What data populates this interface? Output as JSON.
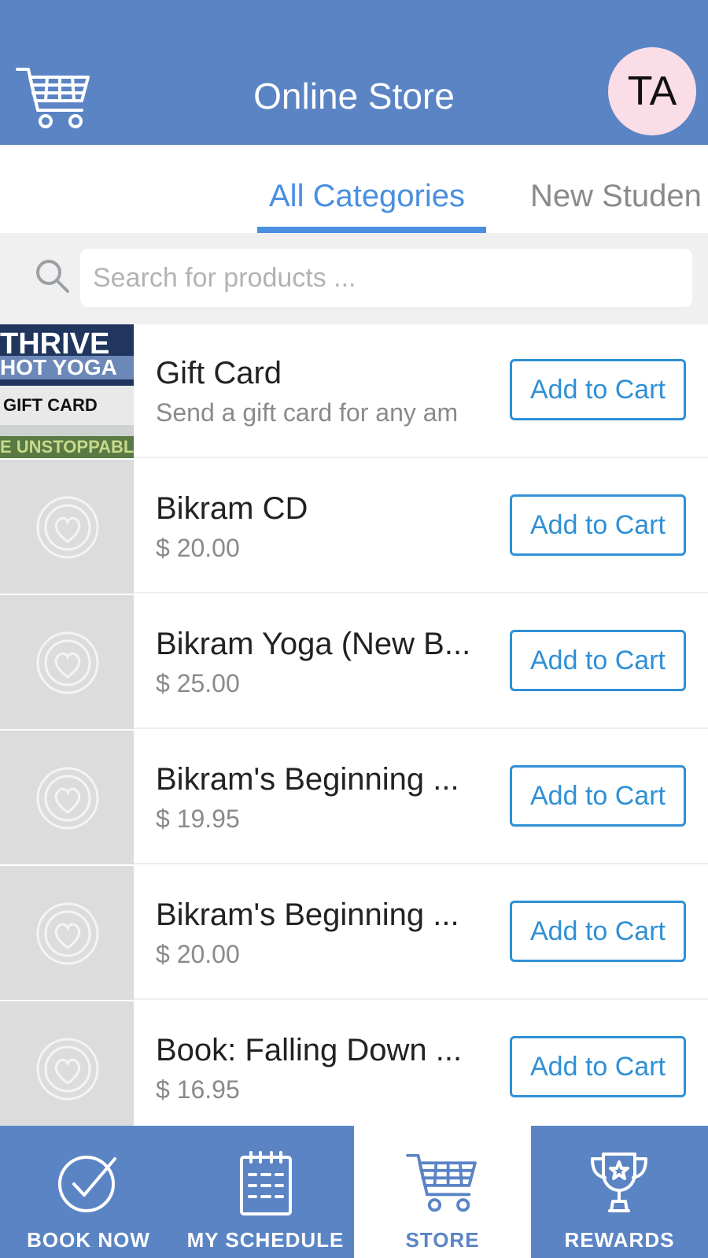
{
  "header": {
    "title": "Online Store",
    "avatar_initials": "TA"
  },
  "tabs": [
    {
      "label": "All Categories",
      "active": true
    },
    {
      "label": "New Studen",
      "active": false
    }
  ],
  "search": {
    "placeholder": "Search for products ..."
  },
  "products": [
    {
      "title": "Gift Card",
      "subtitle": "Send a gift card for any am",
      "button": "Add to Cart",
      "thumb_text": [
        "THRIVE",
        "HOT YOGA",
        "GIFT CARD",
        "E UNSTOPPABL"
      ]
    },
    {
      "title": "Bikram CD",
      "subtitle": "$ 20.00",
      "button": "Add to Cart"
    },
    {
      "title": "Bikram Yoga (New B...",
      "subtitle": "$ 25.00",
      "button": "Add to Cart"
    },
    {
      "title": "Bikram's Beginning ...",
      "subtitle": "$ 19.95",
      "button": "Add to Cart"
    },
    {
      "title": "Bikram's Beginning ...",
      "subtitle": "$ 20.00",
      "button": "Add to Cart"
    },
    {
      "title": "Book: Falling Down ...",
      "subtitle": "$ 16.95",
      "button": "Add to Cart"
    }
  ],
  "bottom_nav": [
    {
      "label": "BOOK NOW",
      "icon": "check-circle-icon",
      "active": false
    },
    {
      "label": "MY SCHEDULE",
      "icon": "calendar-icon",
      "active": false
    },
    {
      "label": "STORE",
      "icon": "cart-icon",
      "active": true
    },
    {
      "label": "REWARDS",
      "icon": "trophy-icon",
      "active": false
    }
  ],
  "colors": {
    "primary": "#5b84c5",
    "accent": "#4a8fe0",
    "button": "#2f90d6"
  }
}
